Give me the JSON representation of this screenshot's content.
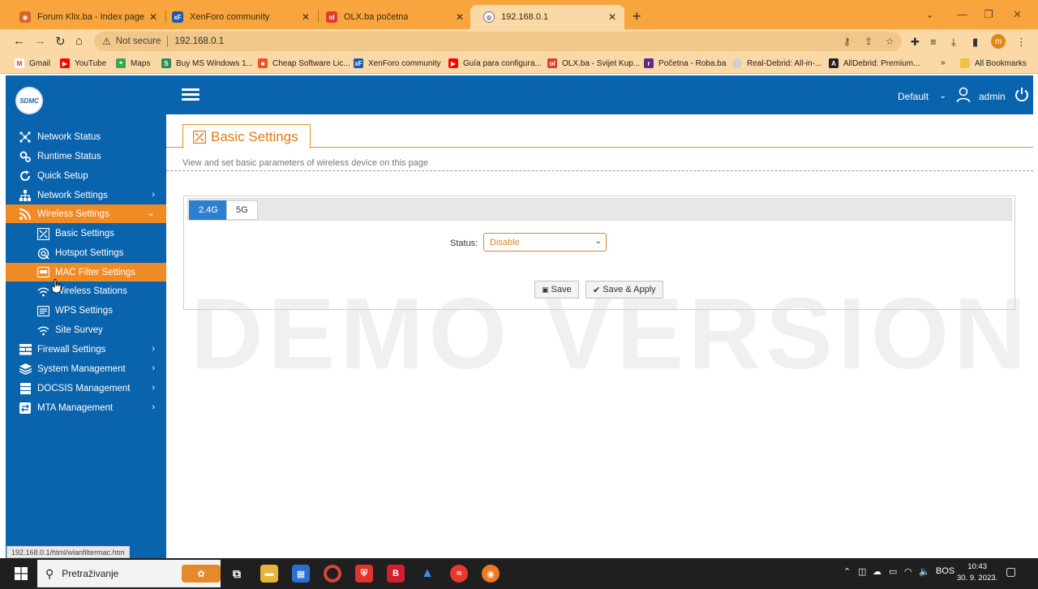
{
  "browser": {
    "tabs": [
      {
        "label": "Forum Klix.ba - Index page",
        "favicon": "klix-globe-icon",
        "color": "#d9622b"
      },
      {
        "label": "XenForo community",
        "favicon": "xenforo-icon",
        "color": "#1e5aa8"
      },
      {
        "label": "OLX.ba početna",
        "favicon": "olx-icon",
        "color": "#e03c31"
      },
      {
        "label": "192.168.0.1",
        "favicon": "globe-icon",
        "color": "#555555"
      }
    ],
    "new_tab": "+",
    "address": {
      "security_label": "Not secure",
      "url": "192.168.0.1"
    },
    "profile_initial": "m",
    "bookmarks": [
      {
        "label": "Gmail",
        "icon": "gmail-icon",
        "color": "#d93025"
      },
      {
        "label": "YouTube",
        "icon": "youtube-icon",
        "color": "#ff0000"
      },
      {
        "label": "Maps",
        "icon": "maps-icon",
        "color": "#34a853"
      },
      {
        "label": "Buy MS Windows 1...",
        "icon": "dollar-icon",
        "color": "#2e8b57"
      },
      {
        "label": "Cheap Software Lic...",
        "icon": "windows-logo-icon",
        "color": "#f25022"
      },
      {
        "label": "XenForo community",
        "icon": "xenforo-icon",
        "color": "#1e5aa8"
      },
      {
        "label": "Guía para configura...",
        "icon": "youtube-icon",
        "color": "#ff0000"
      },
      {
        "label": "OLX.ba - Svijet Kup...",
        "icon": "olx-icon",
        "color": "#e03c31"
      },
      {
        "label": "Početna - Roba.ba",
        "icon": "roba-icon",
        "color": "#5b2a86"
      },
      {
        "label": "Real-Debrid: All-in-...",
        "icon": "circle-icon",
        "color": "#cfcfcf"
      },
      {
        "label": "AllDebrid: Premium...",
        "icon": "alldebrid-icon",
        "color": "#222222"
      }
    ],
    "all_bookmarks": "All Bookmarks",
    "status_url": "192.168.0.1/html/wlanfiltermac.htm"
  },
  "router": {
    "logo_text": "SDMC",
    "profile": "Default",
    "user": "admin",
    "sidebar": [
      {
        "label": "Network Status",
        "icon": "network-status-icon"
      },
      {
        "label": "Runtime Status",
        "icon": "runtime-status-icon"
      },
      {
        "label": "Quick Setup",
        "icon": "quick-setup-icon"
      },
      {
        "label": "Network Settings",
        "icon": "network-settings-icon"
      },
      {
        "label": "Wireless Settings",
        "icon": "wireless-icon"
      },
      {
        "label": "Basic Settings",
        "icon": "basic-settings-icon"
      },
      {
        "label": "Hotspot Settings",
        "icon": "hotspot-icon"
      },
      {
        "label": "MAC Filter Settings",
        "icon": "mac-filter-icon"
      },
      {
        "label": "Wireless Stations",
        "icon": "wifi-icon"
      },
      {
        "label": "WPS Settings",
        "icon": "wps-icon"
      },
      {
        "label": "Site Survey",
        "icon": "wifi-icon"
      },
      {
        "label": "Firewall Settings",
        "icon": "firewall-icon"
      },
      {
        "label": "System Management",
        "icon": "system-icon"
      },
      {
        "label": "DOCSIS Management",
        "icon": "docsis-icon"
      },
      {
        "label": "MTA Management",
        "icon": "mta-icon"
      }
    ],
    "page": {
      "title": "Basic Settings",
      "description": "View and set basic parameters of wireless device on this page",
      "watermark": "DEMO VERSION",
      "band_tabs": [
        "2.4G",
        "5G"
      ],
      "selected_band": "2.4G",
      "status_label": "Status:",
      "status_value": "Disable",
      "save_label": "Save",
      "save_apply_label": "Save & Apply"
    }
  },
  "taskbar": {
    "search_placeholder": "Pretraživanje",
    "language": "BOS",
    "time": "10:43",
    "date": "30. 9. 2023."
  }
}
